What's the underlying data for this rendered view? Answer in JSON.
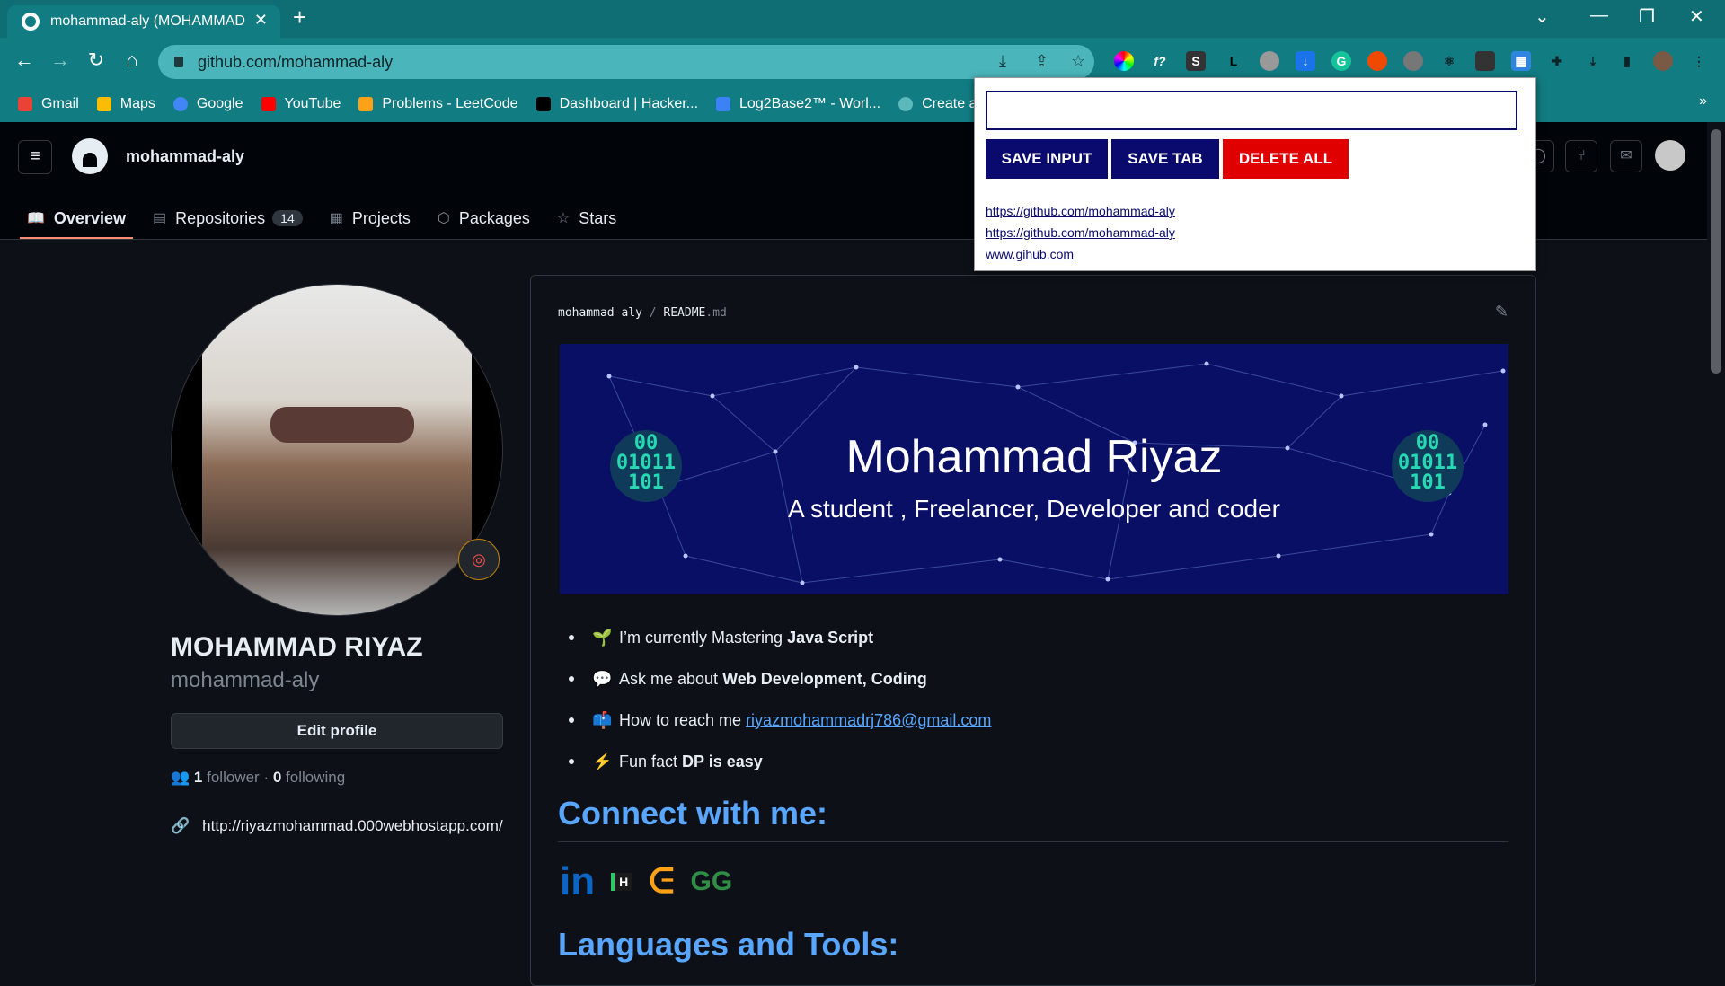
{
  "browser": {
    "tab_title": "mohammad-aly (MOHAMMAD",
    "new_tab": "+",
    "url": "github.com/mohammad-aly",
    "bookmarks": [
      {
        "label": "Gmail",
        "color": "#ea4335"
      },
      {
        "label": "Maps",
        "color": "#fbbc05"
      },
      {
        "label": "Google",
        "color": "#4285f4"
      },
      {
        "label": "YouTube",
        "color": "#ff0000"
      },
      {
        "label": "Problems - LeetCode",
        "color": "#ffa116"
      },
      {
        "label": "Dashboard | Hacker...",
        "color": "#000000"
      },
      {
        "label": "Log2Base2™ - Worl...",
        "color": "#3b82f6"
      },
      {
        "label": "Create a New",
        "color": "#0e6e74"
      }
    ],
    "bookmarks_more": "»"
  },
  "github": {
    "header_user": "mohammad-aly",
    "tabs": [
      {
        "label": "Overview",
        "icon": "book-icon"
      },
      {
        "label": "Repositories",
        "icon": "repo-icon",
        "count": "14"
      },
      {
        "label": "Projects",
        "icon": "table-icon"
      },
      {
        "label": "Packages",
        "icon": "package-icon"
      },
      {
        "label": "Stars",
        "icon": "star-icon"
      }
    ],
    "profile": {
      "name": "MOHAMMAD RIYAZ",
      "login": "mohammad-aly",
      "edit_button": "Edit profile",
      "followers": "1",
      "followers_label": "follower",
      "following": "0",
      "following_label": "following",
      "separator": "·",
      "website": "http://riyazmohammad.000webhostapp.com/"
    },
    "readme": {
      "owner": "mohammad-aly",
      "separator": "/",
      "file": "README",
      "ext": ".md",
      "banner_title": "Mohammad Riyaz",
      "banner_subtitle": "A student , Freelancer, Developer and coder",
      "binary_text": [
        "00",
        "01011",
        "101",
        "10"
      ],
      "bullets": [
        {
          "emoji": "🌱",
          "text": "I’m currently Mastering",
          "bold": "Java Script"
        },
        {
          "emoji": "💬",
          "text": "Ask me about",
          "bold": "Web Development, Coding"
        },
        {
          "emoji": "📫",
          "text": "How to reach me",
          "link": "riyazmohammadrj786@gmail.com"
        },
        {
          "emoji": "⚡",
          "text": "Fun fact",
          "bold": "DP is easy"
        }
      ],
      "connect_heading": "Connect with me:",
      "socials": [
        "in",
        "H",
        "ᕮ",
        "GG"
      ],
      "languages_heading": "Languages and Tools:"
    }
  },
  "popup": {
    "input_value": "",
    "save_input": "SAVE INPUT",
    "save_tab": "SAVE TAB",
    "delete_all": "DELETE ALL",
    "links": [
      "https://github.com/mohammad-aly",
      "https://github.com/mohammad-aly",
      "www.gihub.com"
    ],
    "colors": {
      "primary": "#0a0a6e",
      "danger": "#e00000"
    }
  }
}
